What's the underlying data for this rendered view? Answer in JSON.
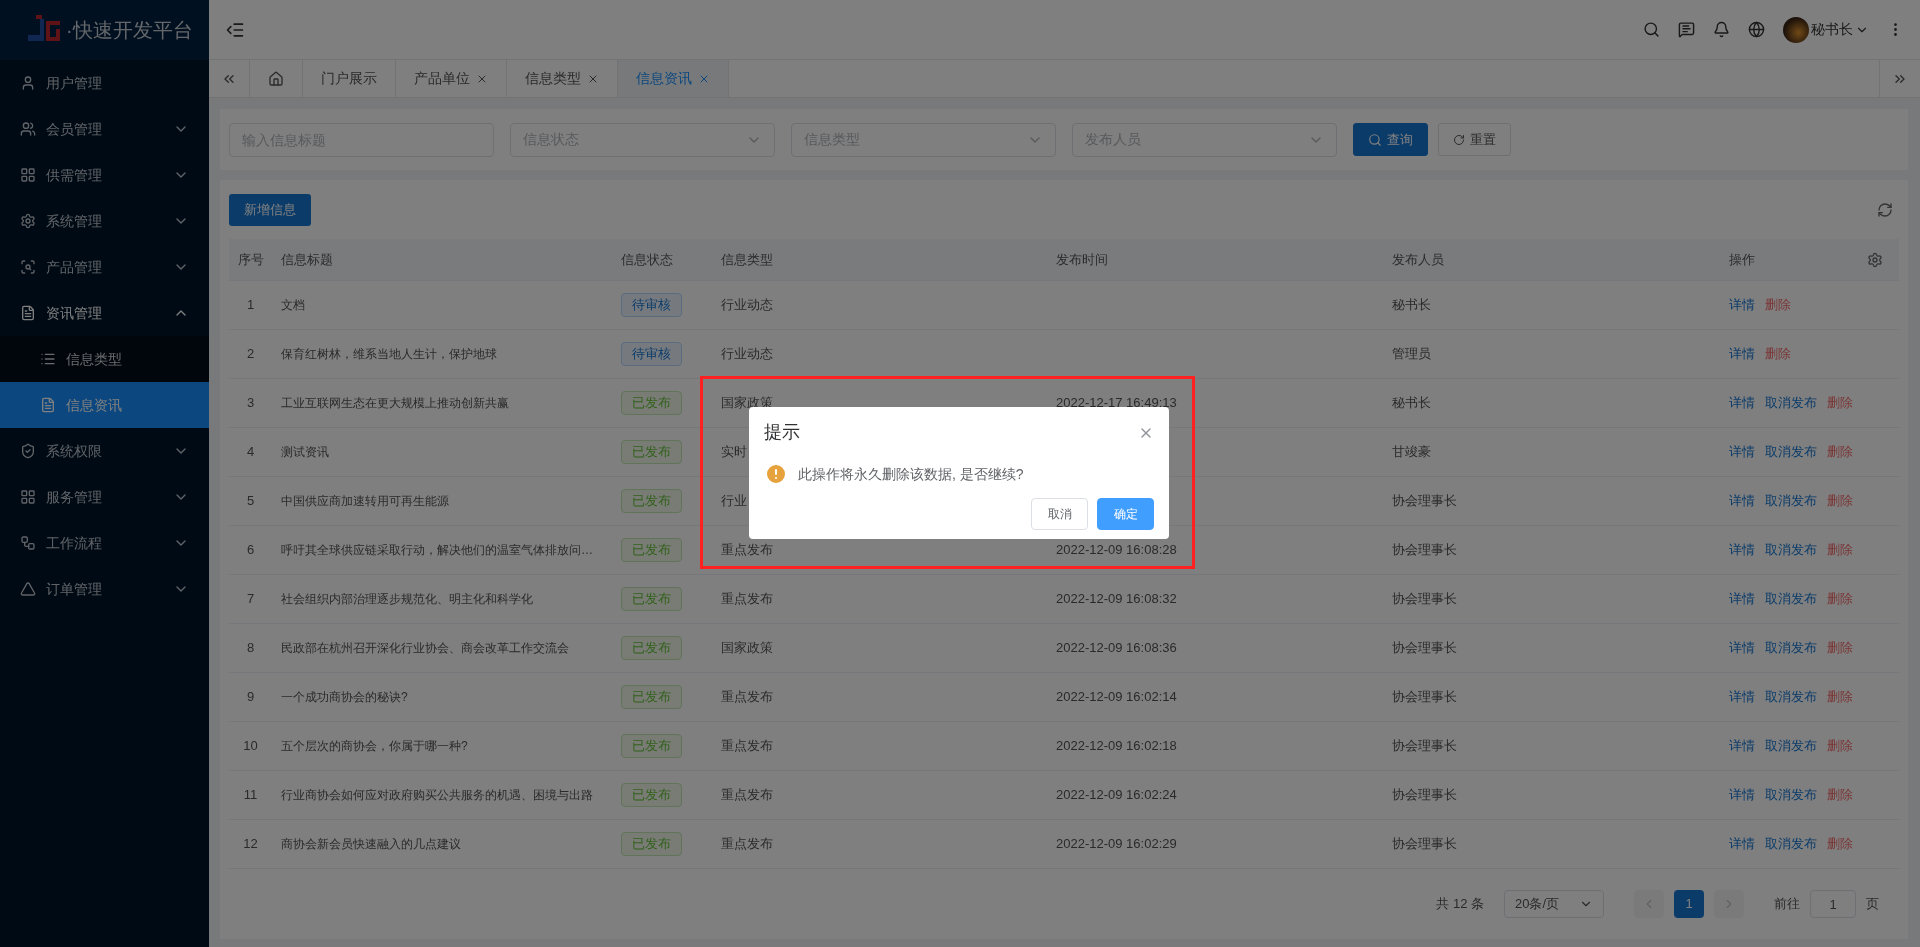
{
  "brand": {
    "title": "·快速开发平台"
  },
  "sidebar": {
    "items": [
      {
        "label": "用户管理",
        "kind": "user"
      },
      {
        "label": "会员管理",
        "kind": "members",
        "expanded": false
      },
      {
        "label": "供需管理",
        "kind": "grid",
        "expanded": false
      },
      {
        "label": "系统管理",
        "kind": "gear",
        "expanded": false
      },
      {
        "label": "产品管理",
        "kind": "product",
        "expanded": false
      },
      {
        "label": "资讯管理",
        "kind": "doc",
        "expanded": true,
        "children": [
          {
            "label": "信息类型",
            "kind": "list",
            "selected": false
          },
          {
            "label": "信息资讯",
            "kind": "doc",
            "selected": true
          }
        ]
      },
      {
        "label": "系统权限",
        "kind": "shield",
        "expanded": false
      },
      {
        "label": "服务管理",
        "kind": "grid",
        "expanded": false
      },
      {
        "label": "工作流程",
        "kind": "flow",
        "expanded": false
      },
      {
        "label": "订单管理",
        "kind": "triangle",
        "expanded": false
      }
    ]
  },
  "header": {
    "user": "秘书长"
  },
  "tabs": [
    {
      "kind": "home",
      "selected": false,
      "closable": false
    },
    {
      "label": "门户展示",
      "selected": false,
      "closable": false
    },
    {
      "label": "产品单位",
      "selected": false,
      "closable": true
    },
    {
      "label": "信息类型",
      "selected": false,
      "closable": true
    },
    {
      "label": "信息资讯",
      "selected": true,
      "closable": true
    }
  ],
  "filters": {
    "fields": [
      {
        "kind": "input",
        "placeholder": "输入信息标题"
      },
      {
        "kind": "select",
        "placeholder": "信息状态"
      },
      {
        "kind": "select",
        "placeholder": "信息类型"
      },
      {
        "kind": "select",
        "placeholder": "发布人员"
      }
    ],
    "buttons": [
      {
        "label": "查询",
        "kind": "primary"
      },
      {
        "label": "重置",
        "kind": "default"
      }
    ]
  },
  "toolbar": {
    "add_button": "新增信息"
  },
  "table": {
    "columns": [
      "序号",
      "信息标题",
      "信息状态",
      "信息类型",
      "发布时间",
      "发布人员",
      "操作"
    ],
    "rows": [
      {
        "no": "1",
        "title": "文档",
        "status": {
          "label": "待审核",
          "kind": "pending"
        },
        "type": "行业动态",
        "time": "",
        "person": "秘书长",
        "actions": [
          {
            "label": "详情",
            "kind": "primary"
          },
          {
            "label": "删除",
            "kind": "danger"
          }
        ]
      },
      {
        "no": "2",
        "title": "保育红树林，维系当地人生计，保护地球",
        "status": {
          "label": "待审核",
          "kind": "pending"
        },
        "type": "行业动态",
        "time": "",
        "person": "管理员",
        "actions": [
          {
            "label": "详情",
            "kind": "primary"
          },
          {
            "label": "删除",
            "kind": "danger"
          }
        ]
      },
      {
        "no": "3",
        "title": "工业互联网生态在更大规模上推动创新共赢",
        "status": {
          "label": "已发布",
          "kind": "published"
        },
        "type": "国家政策",
        "time": "2022-12-17 16:49:13",
        "person": "秘书长",
        "actions": [
          {
            "label": "详情",
            "kind": "primary"
          },
          {
            "label": "取消发布",
            "kind": "primary"
          },
          {
            "label": "删除",
            "kind": "danger"
          }
        ]
      },
      {
        "no": "4",
        "title": "测试资讯",
        "status": {
          "label": "已发布",
          "kind": "published"
        },
        "type": "实时",
        "time": "",
        "person": "甘竣豪",
        "actions": [
          {
            "label": "详情",
            "kind": "primary"
          },
          {
            "label": "取消发布",
            "kind": "primary"
          },
          {
            "label": "删除",
            "kind": "danger"
          }
        ]
      },
      {
        "no": "5",
        "title": "中国供应商加速转用可再生能源",
        "status": {
          "label": "已发布",
          "kind": "published"
        },
        "type": "行业",
        "time": "",
        "person": "协会理事长",
        "actions": [
          {
            "label": "详情",
            "kind": "primary"
          },
          {
            "label": "取消发布",
            "kind": "primary"
          },
          {
            "label": "删除",
            "kind": "danger"
          }
        ]
      },
      {
        "no": "6",
        "title": "呼吁其全球供应链采取行动，解决他们的温室气体排放问…",
        "status": {
          "label": "已发布",
          "kind": "published"
        },
        "type": "重点发布",
        "time": "2022-12-09 16:08:28",
        "person": "协会理事长",
        "actions": [
          {
            "label": "详情",
            "kind": "primary"
          },
          {
            "label": "取消发布",
            "kind": "primary"
          },
          {
            "label": "删除",
            "kind": "danger"
          }
        ]
      },
      {
        "no": "7",
        "title": "社会组织内部治理逐步规范化、明主化和科学化",
        "status": {
          "label": "已发布",
          "kind": "published"
        },
        "type": "重点发布",
        "time": "2022-12-09 16:08:32",
        "person": "协会理事长",
        "actions": [
          {
            "label": "详情",
            "kind": "primary"
          },
          {
            "label": "取消发布",
            "kind": "primary"
          },
          {
            "label": "删除",
            "kind": "danger"
          }
        ]
      },
      {
        "no": "8",
        "title": "民政部在杭州召开深化行业协会、商会改革工作交流会",
        "status": {
          "label": "已发布",
          "kind": "published"
        },
        "type": "国家政策",
        "time": "2022-12-09 16:08:36",
        "person": "协会理事长",
        "actions": [
          {
            "label": "详情",
            "kind": "primary"
          },
          {
            "label": "取消发布",
            "kind": "primary"
          },
          {
            "label": "删除",
            "kind": "danger"
          }
        ]
      },
      {
        "no": "9",
        "title": "一个成功商协会的秘诀?",
        "status": {
          "label": "已发布",
          "kind": "published"
        },
        "type": "重点发布",
        "time": "2022-12-09 16:02:14",
        "person": "协会理事长",
        "actions": [
          {
            "label": "详情",
            "kind": "primary"
          },
          {
            "label": "取消发布",
            "kind": "primary"
          },
          {
            "label": "删除",
            "kind": "danger"
          }
        ]
      },
      {
        "no": "10",
        "title": "五个层次的商协会，你属于哪一种?",
        "status": {
          "label": "已发布",
          "kind": "published"
        },
        "type": "重点发布",
        "time": "2022-12-09 16:02:18",
        "person": "协会理事长",
        "actions": [
          {
            "label": "详情",
            "kind": "primary"
          },
          {
            "label": "取消发布",
            "kind": "primary"
          },
          {
            "label": "删除",
            "kind": "danger"
          }
        ]
      },
      {
        "no": "11",
        "title": "行业商协会如何应对政府购买公共服务的机遇、困境与出路",
        "status": {
          "label": "已发布",
          "kind": "published"
        },
        "type": "重点发布",
        "time": "2022-12-09 16:02:24",
        "person": "协会理事长",
        "actions": [
          {
            "label": "详情",
            "kind": "primary"
          },
          {
            "label": "取消发布",
            "kind": "primary"
          },
          {
            "label": "删除",
            "kind": "danger"
          }
        ]
      },
      {
        "no": "12",
        "title": "商协会新会员快速融入的几点建议",
        "status": {
          "label": "已发布",
          "kind": "published"
        },
        "type": "重点发布",
        "time": "2022-12-09 16:02:29",
        "person": "协会理事长",
        "actions": [
          {
            "label": "详情",
            "kind": "primary"
          },
          {
            "label": "取消发布",
            "kind": "primary"
          },
          {
            "label": "删除",
            "kind": "danger"
          }
        ]
      }
    ]
  },
  "pagination": {
    "total": "共 12 条",
    "page_size": "20条/页",
    "pages": [
      {
        "label": "1",
        "selected": true
      }
    ],
    "goto_label": "前往",
    "goto_value": "1",
    "goto_suffix": "页"
  },
  "dialog": {
    "title": "提示",
    "message": "此操作将永久删除该数据, 是否继续?",
    "buttons": [
      {
        "label": "取消",
        "kind": "default"
      },
      {
        "label": "确定",
        "kind": "primary"
      }
    ]
  }
}
